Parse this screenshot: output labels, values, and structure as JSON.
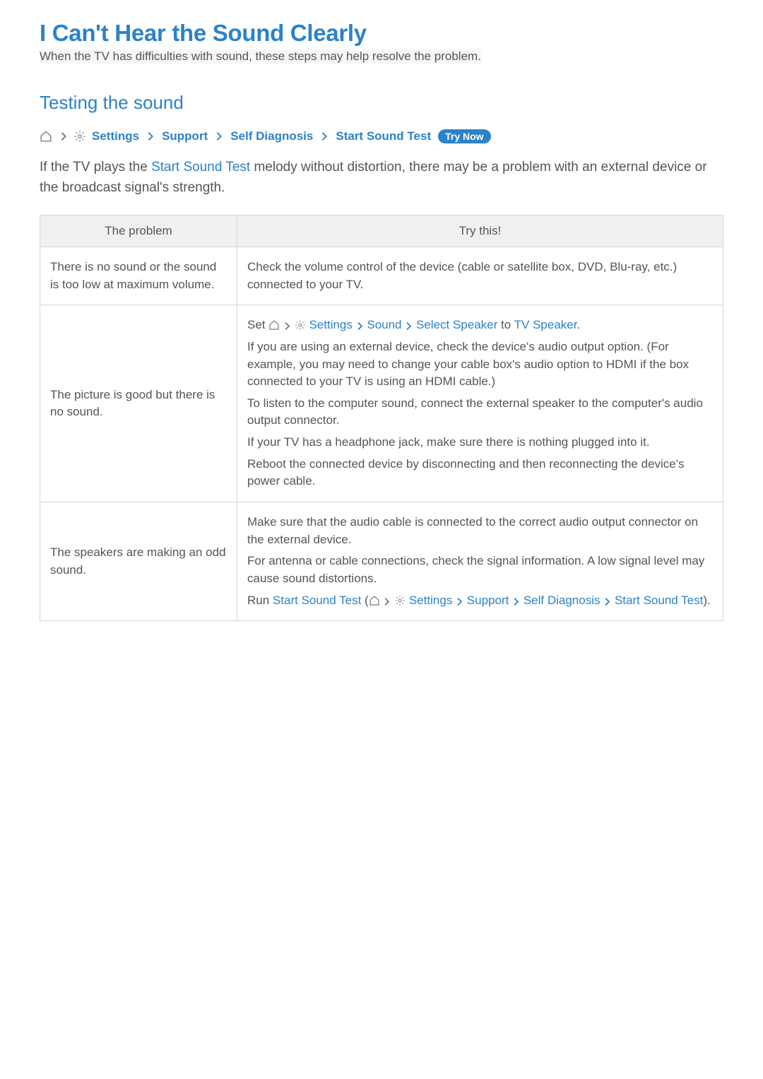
{
  "header": {
    "title": "I Can't Hear the Sound Clearly",
    "subtitle": "When the TV has difficulties with sound, these steps may help resolve the problem."
  },
  "section": {
    "title": "Testing the sound"
  },
  "nav": {
    "settings": "Settings",
    "support": "Support",
    "self_diagnosis": "Self Diagnosis",
    "start_sound_test": "Start Sound Test",
    "try_now": "Try Now"
  },
  "paragraph": {
    "pre": "If the TV plays the ",
    "link": "Start Sound Test",
    "post": " melody without distortion, there may be a problem with an external device or the broadcast signal's strength."
  },
  "table": {
    "header_problem": "The problem",
    "header_trythis": "Try this!",
    "rows": [
      {
        "problem": "There is no sound or the sound is too low at maximum volume.",
        "solution": [
          {
            "type": "plain",
            "text": "Check the volume control of the device (cable or satellite box, DVD, Blu-ray, etc.) connected to your TV."
          }
        ]
      },
      {
        "problem": "The picture is good but there is no sound.",
        "solution": [
          {
            "type": "set_path",
            "pre": "Set ",
            "segments": [
              "Settings",
              "Sound",
              "Select Speaker"
            ],
            "mid": " to ",
            "target": "TV Speaker",
            "post": "."
          },
          {
            "type": "plain",
            "text": "If you are using an external device, check the device's audio output option. (For example, you may need to change your cable box's audio option to HDMI if the box connected to your TV is using an HDMI cable.)"
          },
          {
            "type": "plain",
            "text": "To listen to the computer sound, connect the external speaker to the computer's audio output connector."
          },
          {
            "type": "plain",
            "text": "If your TV has a headphone jack, make sure there is nothing plugged into it."
          },
          {
            "type": "plain",
            "text": "Reboot the connected device by disconnecting and then reconnecting the device's power cable."
          }
        ]
      },
      {
        "problem": "The speakers are making an odd sound.",
        "solution": [
          {
            "type": "plain",
            "text": "Make sure that the audio cable is connected to the correct audio output connector on the external device."
          },
          {
            "type": "plain",
            "text": "For antenna or cable connections, check the signal information. A low signal level may cause sound distortions."
          },
          {
            "type": "run_path",
            "pre": "Run ",
            "linktext": "Start Sound Test",
            "segments": [
              "Settings",
              "Support",
              "Self Diagnosis",
              "Start Sound Test"
            ],
            "post": ")."
          }
        ]
      }
    ]
  }
}
